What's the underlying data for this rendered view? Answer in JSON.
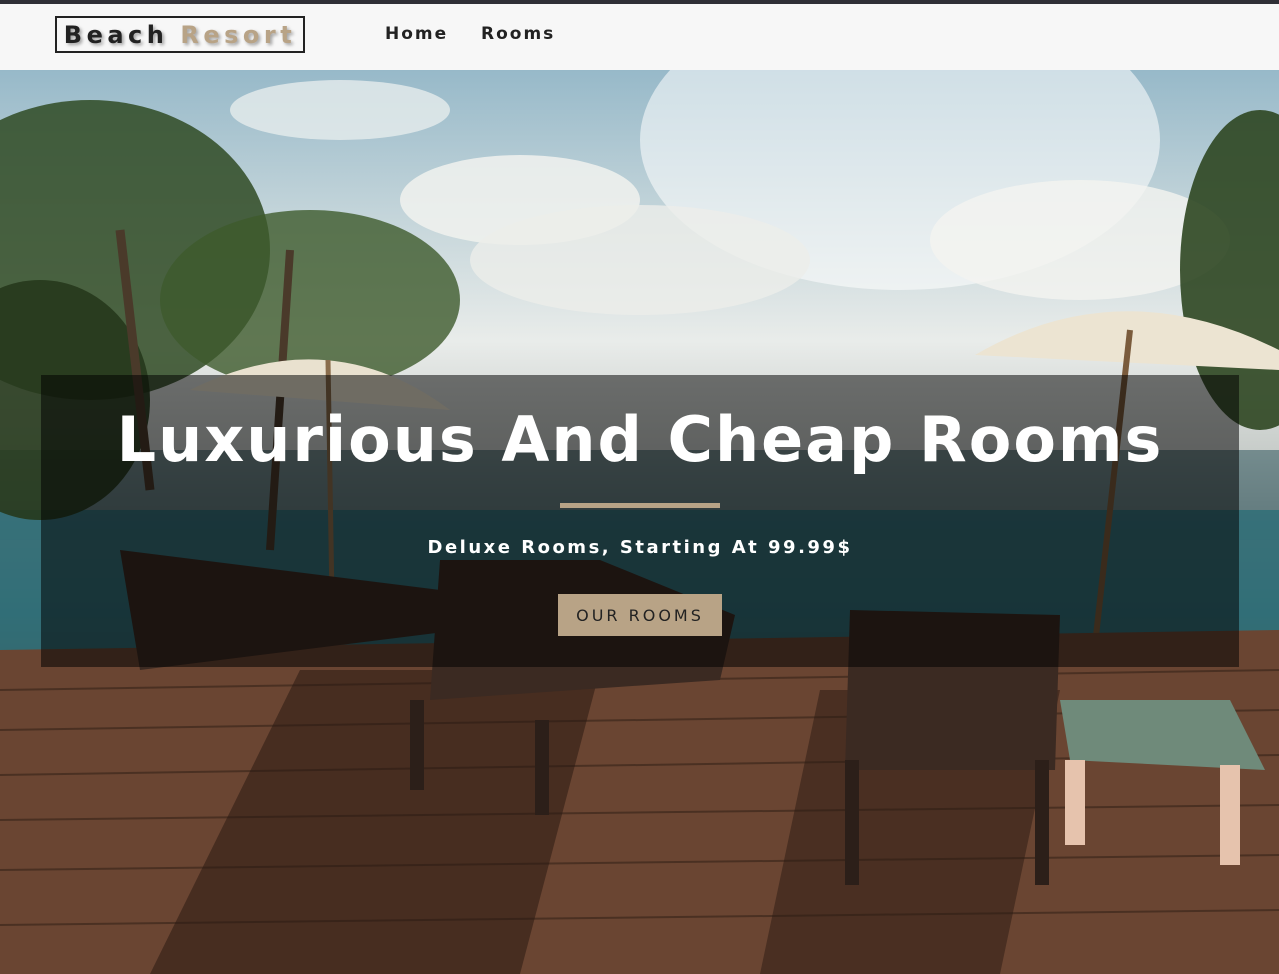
{
  "navbar": {
    "logo_word1": "Beach",
    "logo_word2": "Resort",
    "links": [
      {
        "label": "Home"
      },
      {
        "label": "Rooms"
      }
    ]
  },
  "hero": {
    "title": "Luxurious And Cheap Rooms",
    "subtitle": "Deluxe Rooms, Starting At 99.99$",
    "button_label": "OUR ROOMS"
  },
  "colors": {
    "accent": "#b8a386",
    "dark": "#222222",
    "navbar_bg": "#f7f7f7"
  }
}
